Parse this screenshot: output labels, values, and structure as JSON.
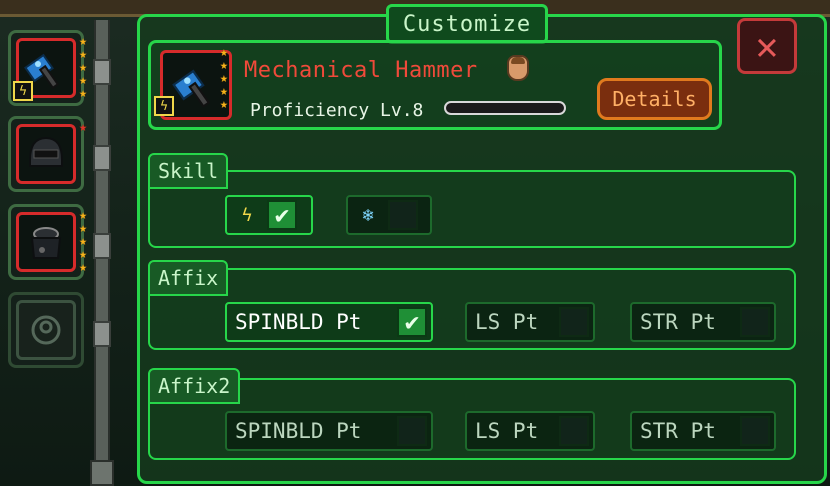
{
  "window": {
    "title": "Customize",
    "close_symbol": "✕"
  },
  "equipment_slots": [
    {
      "id": "hammer",
      "stars": 5,
      "has_bolt": true,
      "state": "equipped"
    },
    {
      "id": "helmet",
      "stars": 1,
      "star_color": "red",
      "has_bolt": false,
      "state": "equipped"
    },
    {
      "id": "armor",
      "stars": 5,
      "has_bolt": false,
      "state": "equipped"
    },
    {
      "id": "empty",
      "stars": 0,
      "state": "empty"
    }
  ],
  "item": {
    "name": "Mechanical Hammer",
    "stars": 5,
    "proficiency_label": "Proficiency Lv.8",
    "proficiency_progress": 0.0,
    "details_label": "Details"
  },
  "skill": {
    "title": "Skill",
    "options": [
      {
        "icon": "lightning-icon",
        "checked": true
      },
      {
        "icon": "frost-icon",
        "checked": false
      }
    ]
  },
  "affix": {
    "title": "Affix",
    "options": [
      {
        "label": "SPINBLD Pt",
        "checked": true
      },
      {
        "label": "LS Pt",
        "checked": false
      },
      {
        "label": "STR Pt",
        "checked": false
      }
    ]
  },
  "affix2": {
    "title": "Affix2",
    "options": [
      {
        "label": "SPINBLD Pt",
        "checked": false
      },
      {
        "label": "LS Pt",
        "checked": false
      },
      {
        "label": "STR Pt",
        "checked": false
      }
    ]
  },
  "colors": {
    "accent": "#27d64a",
    "item_name": "#f04a3a",
    "details": "#e07a1e",
    "close": "#c43a3a"
  }
}
